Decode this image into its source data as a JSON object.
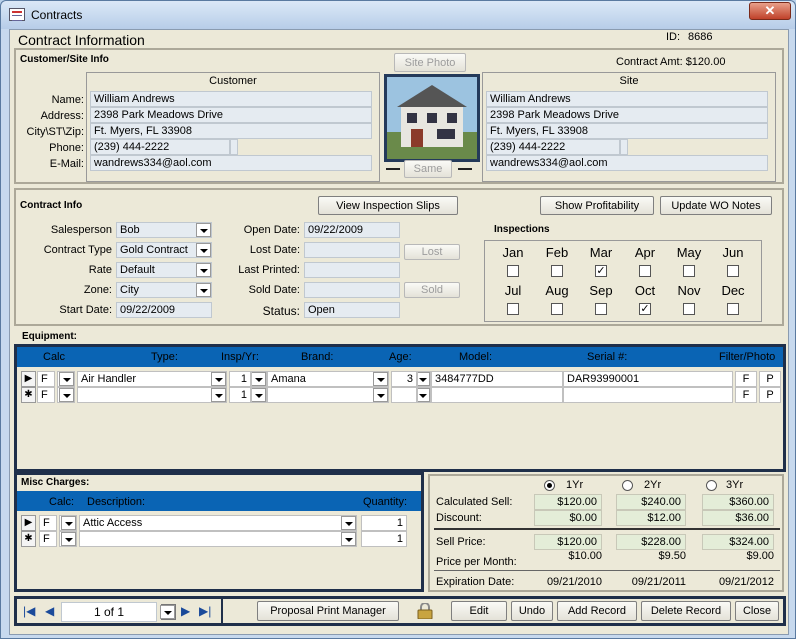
{
  "window": {
    "title": "Contracts",
    "close": "✕"
  },
  "header": {
    "form_title": "Contract Information",
    "id_label": "ID:",
    "id_value": "8686",
    "contract_amt": "Contract Amt: $120.00"
  },
  "customer_site": {
    "section_title": "Customer/Site Info",
    "site_photo_btn": "Site Photo",
    "same_btn": "Same",
    "customer_header": "Customer",
    "site_header": "Site",
    "labels": {
      "name": "Name:",
      "address": "Address:",
      "city": "City\\ST\\Zip:",
      "phone": "Phone:",
      "email": "E-Mail:"
    },
    "customer": {
      "name": "William Andrews",
      "address": "2398 Park Meadows Drive",
      "city": "Ft. Myers, FL 33908",
      "phone": "(239) 444-2222",
      "email": "wandrews334@aol.com"
    },
    "site": {
      "name": "William Andrews",
      "address": "2398 Park Meadows Drive",
      "city": "Ft. Myers, FL 33908",
      "phone": "(239) 444-2222",
      "email": "wandrews334@aol.com"
    }
  },
  "contract": {
    "section_title": "Contract Info",
    "view_slips_btn": "View Inspection Slips",
    "show_profit_btn": "Show Profitability",
    "update_wo_btn": "Update WO Notes",
    "labels": {
      "salesperson": "Salesperson",
      "contract_type": "Contract Type",
      "rate": "Rate",
      "zone": "Zone:",
      "start_date": "Start Date:",
      "open_date": "Open Date:",
      "lost_date": "Lost Date:",
      "last_printed": "Last Printed:",
      "sold_date": "Sold Date:",
      "status": "Status:"
    },
    "salesperson": "Bob",
    "contract_type": "Gold Contract",
    "rate": "Default",
    "zone": "City",
    "start_date": "09/22/2009",
    "open_date": "09/22/2009",
    "status": "Open",
    "lost_btn": "Lost",
    "sold_btn": "Sold"
  },
  "inspections": {
    "title": "Inspections",
    "months": [
      {
        "label": "Jan",
        "checked": false
      },
      {
        "label": "Feb",
        "checked": false
      },
      {
        "label": "Mar",
        "checked": true
      },
      {
        "label": "Apr",
        "checked": false
      },
      {
        "label": "May",
        "checked": false
      },
      {
        "label": "Jun",
        "checked": false
      },
      {
        "label": "Jul",
        "checked": false
      },
      {
        "label": "Aug",
        "checked": false
      },
      {
        "label": "Sep",
        "checked": false
      },
      {
        "label": "Oct",
        "checked": true
      },
      {
        "label": "Nov",
        "checked": false
      },
      {
        "label": "Dec",
        "checked": false
      }
    ]
  },
  "equipment": {
    "section_title": "Equipment:",
    "columns": {
      "calc": "Calc",
      "type": "Type:",
      "insp": "Insp/Yr:",
      "brand": "Brand:",
      "age": "Age:",
      "model": "Model:",
      "serial": "Serial #:",
      "filter": "Filter/Photo"
    },
    "row1": {
      "calc": "F",
      "type": "Air Handler",
      "insp": "1",
      "brand": "Amana",
      "age": "3",
      "model": "3484777DD",
      "serial": "DAR93990001",
      "f": "F",
      "p": "P"
    },
    "row2": {
      "calc": "F",
      "insp": "1",
      "f": "F",
      "p": "P"
    }
  },
  "misc": {
    "section_title": "Misc Charges:",
    "columns": {
      "calc": "Calc:",
      "description": "Description:",
      "quantity": "Quantity:"
    },
    "row1": {
      "calc": "F",
      "description": "Attic Access",
      "quantity": "1"
    },
    "row2": {
      "calc": "F",
      "quantity": "1"
    }
  },
  "pricing": {
    "options": [
      {
        "label": "1Yr",
        "selected": true
      },
      {
        "label": "2Yr",
        "selected": false
      },
      {
        "label": "3Yr",
        "selected": false
      }
    ],
    "labels": {
      "calculated": "Calculated Sell:",
      "discount": "Discount:",
      "sell": "Sell Price:",
      "per_month": "Price per Month:",
      "expiration": "Expiration Date:"
    },
    "calculated": [
      "$120.00",
      "$240.00",
      "$360.00"
    ],
    "discount": [
      "$0.00",
      "$12.00",
      "$36.00"
    ],
    "sell": [
      "$120.00",
      "$228.00",
      "$324.00"
    ],
    "per_month": [
      "$10.00",
      "$9.50",
      "$9.00"
    ],
    "expiration": [
      "09/21/2010",
      "09/21/2011",
      "09/21/2012"
    ]
  },
  "footer": {
    "record_text": "1 of  1",
    "proposal_btn": "Proposal Print Manager",
    "edit_btn": "Edit",
    "undo_btn": "Undo",
    "add_btn": "Add Record",
    "delete_btn": "Delete Record",
    "close_btn": "Close"
  }
}
